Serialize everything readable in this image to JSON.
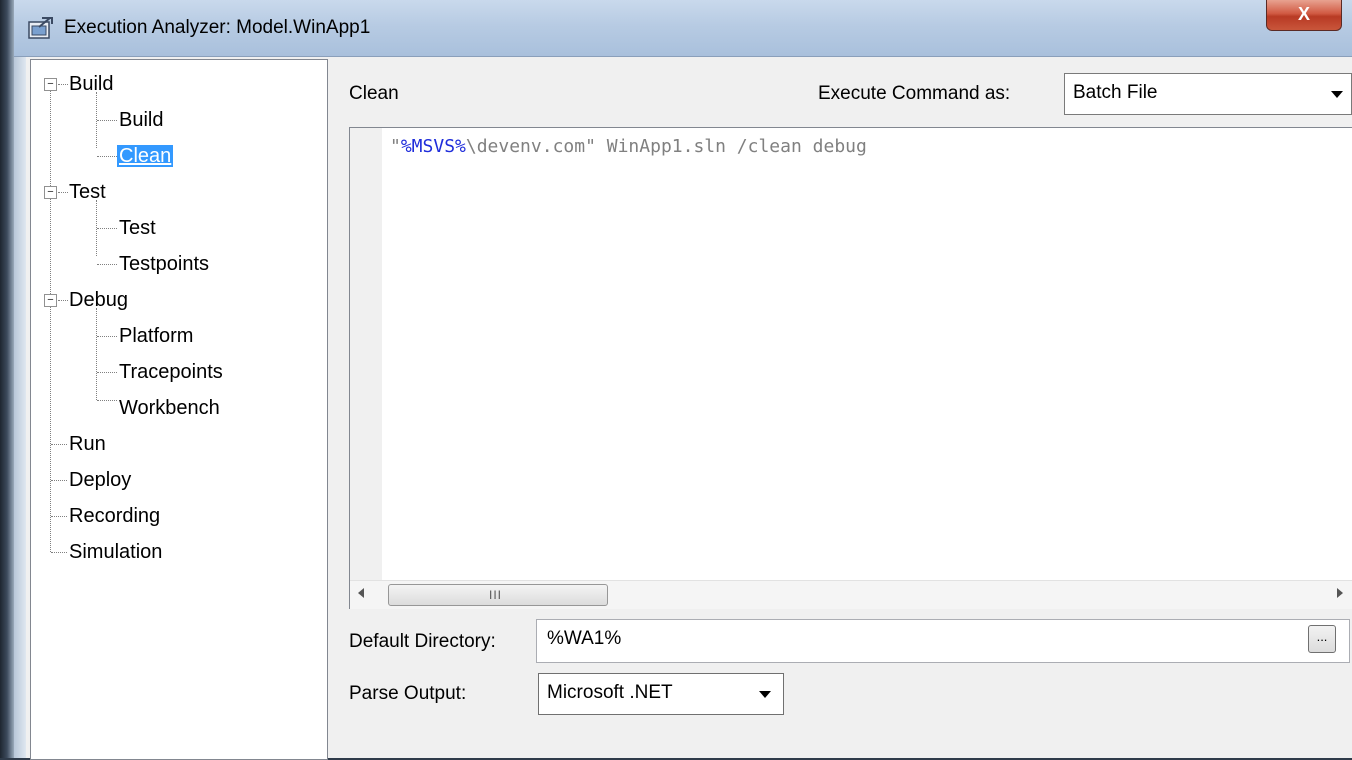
{
  "window": {
    "title": "Execution Analyzer: Model.WinApp1",
    "close_label": "X"
  },
  "tree": {
    "groups": [
      {
        "label": "Build",
        "expander": "−",
        "children": [
          "Build",
          "Clean"
        ]
      },
      {
        "label": "Test",
        "expander": "−",
        "children": [
          "Test",
          "Testpoints"
        ]
      },
      {
        "label": "Debug",
        "expander": "−",
        "children": [
          "Platform",
          "Tracepoints",
          "Workbench"
        ]
      }
    ],
    "leaves": [
      "Run",
      "Deploy",
      "Recording",
      "Simulation"
    ],
    "selected": "Clean"
  },
  "panel": {
    "heading": "Clean",
    "execute_label": "Execute Command as:",
    "execute_value": "Batch File",
    "code_open_quote": "\"",
    "code_var": "%MSVS%",
    "code_rest": "\\devenv.com\" WinApp1.sln /clean debug",
    "scroll_grip": "III",
    "default_dir_label": "Default Directory:",
    "default_dir_value": "%WA1%",
    "browse_label": "...",
    "parse_label": "Parse Output:",
    "parse_value": "Microsoft .NET"
  }
}
